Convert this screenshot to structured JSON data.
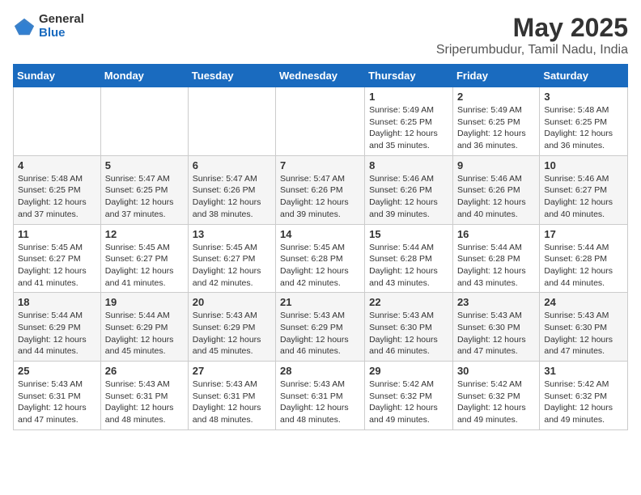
{
  "logo": {
    "general": "General",
    "blue": "Blue"
  },
  "title": {
    "month_year": "May 2025",
    "location": "Sriperumbudur, Tamil Nadu, India"
  },
  "days_of_week": [
    "Sunday",
    "Monday",
    "Tuesday",
    "Wednesday",
    "Thursday",
    "Friday",
    "Saturday"
  ],
  "weeks": [
    [
      {
        "day": "",
        "info": ""
      },
      {
        "day": "",
        "info": ""
      },
      {
        "day": "",
        "info": ""
      },
      {
        "day": "",
        "info": ""
      },
      {
        "day": "1",
        "info": "Sunrise: 5:49 AM\nSunset: 6:25 PM\nDaylight: 12 hours and 35 minutes."
      },
      {
        "day": "2",
        "info": "Sunrise: 5:49 AM\nSunset: 6:25 PM\nDaylight: 12 hours and 36 minutes."
      },
      {
        "day": "3",
        "info": "Sunrise: 5:48 AM\nSunset: 6:25 PM\nDaylight: 12 hours and 36 minutes."
      }
    ],
    [
      {
        "day": "4",
        "info": "Sunrise: 5:48 AM\nSunset: 6:25 PM\nDaylight: 12 hours and 37 minutes."
      },
      {
        "day": "5",
        "info": "Sunrise: 5:47 AM\nSunset: 6:25 PM\nDaylight: 12 hours and 37 minutes."
      },
      {
        "day": "6",
        "info": "Sunrise: 5:47 AM\nSunset: 6:26 PM\nDaylight: 12 hours and 38 minutes."
      },
      {
        "day": "7",
        "info": "Sunrise: 5:47 AM\nSunset: 6:26 PM\nDaylight: 12 hours and 39 minutes."
      },
      {
        "day": "8",
        "info": "Sunrise: 5:46 AM\nSunset: 6:26 PM\nDaylight: 12 hours and 39 minutes."
      },
      {
        "day": "9",
        "info": "Sunrise: 5:46 AM\nSunset: 6:26 PM\nDaylight: 12 hours and 40 minutes."
      },
      {
        "day": "10",
        "info": "Sunrise: 5:46 AM\nSunset: 6:27 PM\nDaylight: 12 hours and 40 minutes."
      }
    ],
    [
      {
        "day": "11",
        "info": "Sunrise: 5:45 AM\nSunset: 6:27 PM\nDaylight: 12 hours and 41 minutes."
      },
      {
        "day": "12",
        "info": "Sunrise: 5:45 AM\nSunset: 6:27 PM\nDaylight: 12 hours and 41 minutes."
      },
      {
        "day": "13",
        "info": "Sunrise: 5:45 AM\nSunset: 6:27 PM\nDaylight: 12 hours and 42 minutes."
      },
      {
        "day": "14",
        "info": "Sunrise: 5:45 AM\nSunset: 6:28 PM\nDaylight: 12 hours and 42 minutes."
      },
      {
        "day": "15",
        "info": "Sunrise: 5:44 AM\nSunset: 6:28 PM\nDaylight: 12 hours and 43 minutes."
      },
      {
        "day": "16",
        "info": "Sunrise: 5:44 AM\nSunset: 6:28 PM\nDaylight: 12 hours and 43 minutes."
      },
      {
        "day": "17",
        "info": "Sunrise: 5:44 AM\nSunset: 6:28 PM\nDaylight: 12 hours and 44 minutes."
      }
    ],
    [
      {
        "day": "18",
        "info": "Sunrise: 5:44 AM\nSunset: 6:29 PM\nDaylight: 12 hours and 44 minutes."
      },
      {
        "day": "19",
        "info": "Sunrise: 5:44 AM\nSunset: 6:29 PM\nDaylight: 12 hours and 45 minutes."
      },
      {
        "day": "20",
        "info": "Sunrise: 5:43 AM\nSunset: 6:29 PM\nDaylight: 12 hours and 45 minutes."
      },
      {
        "day": "21",
        "info": "Sunrise: 5:43 AM\nSunset: 6:29 PM\nDaylight: 12 hours and 46 minutes."
      },
      {
        "day": "22",
        "info": "Sunrise: 5:43 AM\nSunset: 6:30 PM\nDaylight: 12 hours and 46 minutes."
      },
      {
        "day": "23",
        "info": "Sunrise: 5:43 AM\nSunset: 6:30 PM\nDaylight: 12 hours and 47 minutes."
      },
      {
        "day": "24",
        "info": "Sunrise: 5:43 AM\nSunset: 6:30 PM\nDaylight: 12 hours and 47 minutes."
      }
    ],
    [
      {
        "day": "25",
        "info": "Sunrise: 5:43 AM\nSunset: 6:31 PM\nDaylight: 12 hours and 47 minutes."
      },
      {
        "day": "26",
        "info": "Sunrise: 5:43 AM\nSunset: 6:31 PM\nDaylight: 12 hours and 48 minutes."
      },
      {
        "day": "27",
        "info": "Sunrise: 5:43 AM\nSunset: 6:31 PM\nDaylight: 12 hours and 48 minutes."
      },
      {
        "day": "28",
        "info": "Sunrise: 5:43 AM\nSunset: 6:31 PM\nDaylight: 12 hours and 48 minutes."
      },
      {
        "day": "29",
        "info": "Sunrise: 5:42 AM\nSunset: 6:32 PM\nDaylight: 12 hours and 49 minutes."
      },
      {
        "day": "30",
        "info": "Sunrise: 5:42 AM\nSunset: 6:32 PM\nDaylight: 12 hours and 49 minutes."
      },
      {
        "day": "31",
        "info": "Sunrise: 5:42 AM\nSunset: 6:32 PM\nDaylight: 12 hours and 49 minutes."
      }
    ]
  ]
}
